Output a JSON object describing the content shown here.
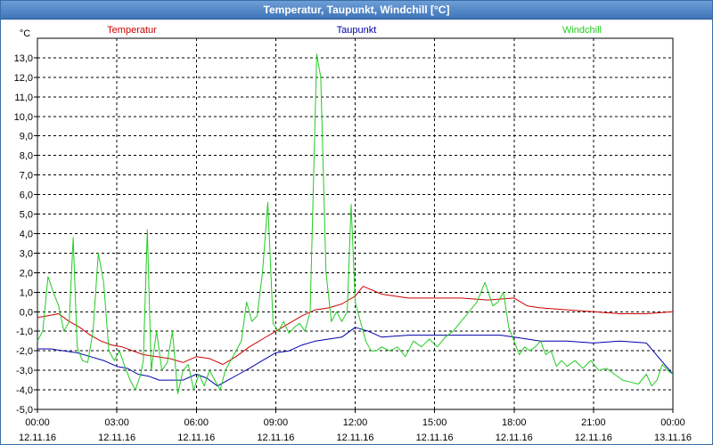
{
  "window": {
    "title": "Temperatur, Taupunkt, Windchill [°C]"
  },
  "colors": {
    "temperatur": "#cc0000",
    "taupunkt": "#0000aa",
    "windchill": "#22cc22",
    "grid": "#000000",
    "axis": "#000000"
  },
  "chart_data": {
    "type": "line",
    "title": "Temperatur, Taupunkt, Windchill [°C]",
    "y_unit": "°C",
    "ylim": [
      -5.0,
      14.0
    ],
    "y_ticks": [
      -5.0,
      -4.0,
      -3.0,
      -2.0,
      -1.0,
      0.0,
      1.0,
      2.0,
      3.0,
      4.0,
      5.0,
      6.0,
      7.0,
      8.0,
      9.0,
      10.0,
      11.0,
      12.0,
      13.0
    ],
    "y_tick_labels": [
      "-5,0",
      "-4,0",
      "-3,0",
      "-2,0",
      "-1,0",
      "0,0",
      "1,0",
      "2,0",
      "3,0",
      "4,0",
      "5,0",
      "6,0",
      "7,0",
      "8,0",
      "9,0",
      "10,0",
      "11,0",
      "12,0",
      "13,0"
    ],
    "xlim": [
      0,
      24
    ],
    "x_ticks": [
      0,
      3,
      6,
      9,
      12,
      15,
      18,
      21,
      24
    ],
    "x_tick_labels": [
      {
        "time": "00:00",
        "date": "12.11.16"
      },
      {
        "time": "03:00",
        "date": "12.11.16"
      },
      {
        "time": "06:00",
        "date": "12.11.16"
      },
      {
        "time": "09:00",
        "date": "12.11.16"
      },
      {
        "time": "12:00",
        "date": "12.11.16"
      },
      {
        "time": "15:00",
        "date": "12.11.16"
      },
      {
        "time": "18:00",
        "date": "12.11.16"
      },
      {
        "time": "21:00",
        "date": "12.11.16"
      },
      {
        "time": "00:00",
        "date": "13.11.16"
      }
    ],
    "grid": true,
    "legend_position": "top",
    "series": [
      {
        "name": "Temperatur",
        "x": [
          0,
          0.4,
          0.8,
          1.2,
          1.6,
          2.0,
          2.4,
          2.8,
          3.2,
          3.6,
          4.0,
          4.5,
          5.0,
          5.5,
          6.0,
          6.5,
          7.0,
          7.5,
          8.0,
          8.5,
          9.0,
          9.5,
          10.0,
          10.5,
          11.0,
          11.5,
          12.0,
          12.3,
          13.0,
          14.0,
          15.0,
          16.0,
          17.0,
          18.0,
          18.5,
          19.0,
          20.0,
          21.0,
          22.0,
          23.0,
          24.0
        ],
        "values": [
          -0.3,
          -0.2,
          -0.1,
          -0.5,
          -0.8,
          -1.2,
          -1.5,
          -1.7,
          -1.8,
          -2.0,
          -2.2,
          -2.3,
          -2.4,
          -2.6,
          -2.3,
          -2.4,
          -2.7,
          -2.3,
          -1.8,
          -1.4,
          -1.0,
          -0.6,
          -0.2,
          0.1,
          0.2,
          0.4,
          0.8,
          1.3,
          0.9,
          0.7,
          0.7,
          0.7,
          0.6,
          0.7,
          0.3,
          0.2,
          0.1,
          0.0,
          -0.1,
          -0.1,
          0.0
        ]
      },
      {
        "name": "Taupunkt",
        "x": [
          0,
          0.5,
          1.0,
          1.5,
          2.0,
          2.5,
          3.0,
          3.4,
          3.8,
          4.2,
          4.6,
          5.0,
          5.5,
          6.0,
          6.4,
          6.8,
          7.2,
          7.6,
          8.0,
          8.5,
          9.0,
          9.5,
          10.0,
          10.5,
          11.0,
          11.5,
          12.0,
          12.5,
          13.0,
          14.0,
          15.0,
          16.0,
          17.0,
          17.5,
          18.0,
          18.5,
          19.0,
          20.0,
          21.0,
          22.0,
          23.0,
          23.5,
          24.0
        ],
        "values": [
          -1.9,
          -1.9,
          -2.0,
          -2.1,
          -2.3,
          -2.5,
          -2.8,
          -2.9,
          -3.2,
          -3.3,
          -3.5,
          -3.5,
          -3.5,
          -3.2,
          -3.4,
          -3.8,
          -3.5,
          -3.2,
          -2.9,
          -2.5,
          -2.1,
          -2.0,
          -1.7,
          -1.5,
          -1.4,
          -1.3,
          -0.8,
          -1.0,
          -1.3,
          -1.2,
          -1.2,
          -1.2,
          -1.2,
          -1.2,
          -1.3,
          -1.4,
          -1.5,
          -1.5,
          -1.6,
          -1.5,
          -1.6,
          -2.4,
          -3.2
        ]
      },
      {
        "name": "Windchill",
        "x": [
          0,
          0.2,
          0.4,
          0.6,
          0.8,
          1.0,
          1.2,
          1.35,
          1.5,
          1.7,
          1.9,
          2.1,
          2.3,
          2.5,
          2.7,
          2.9,
          3.1,
          3.3,
          3.5,
          3.7,
          3.9,
          4.0,
          4.15,
          4.3,
          4.5,
          4.7,
          4.9,
          5.1,
          5.3,
          5.5,
          5.7,
          5.9,
          6.1,
          6.3,
          6.5,
          6.7,
          6.9,
          7.1,
          7.3,
          7.5,
          7.7,
          7.9,
          8.1,
          8.3,
          8.5,
          8.7,
          8.9,
          9.1,
          9.3,
          9.5,
          9.7,
          9.9,
          10.1,
          10.3,
          10.55,
          10.7,
          10.9,
          11.1,
          11.3,
          11.5,
          11.7,
          11.85,
          12.0,
          12.2,
          12.4,
          12.6,
          12.8,
          13.0,
          13.3,
          13.6,
          13.9,
          14.2,
          14.5,
          14.8,
          15.1,
          15.4,
          15.7,
          16.0,
          16.3,
          16.6,
          16.9,
          17.2,
          17.4,
          17.6,
          17.8,
          18.0,
          18.2,
          18.4,
          18.6,
          18.8,
          19.0,
          19.2,
          19.4,
          19.6,
          19.8,
          20.0,
          20.3,
          20.6,
          20.9,
          21.2,
          21.5,
          21.8,
          22.1,
          22.4,
          22.7,
          23.0,
          23.2,
          23.4,
          23.6,
          23.8,
          24.0
        ],
        "values": [
          -1.5,
          -1.0,
          1.8,
          1.0,
          0.3,
          -1.0,
          -0.5,
          3.8,
          -1.8,
          -2.5,
          -2.6,
          -1.0,
          3.0,
          1.5,
          -2.0,
          -2.5,
          -2.0,
          -2.8,
          -3.5,
          -4.0,
          -3.2,
          -2.5,
          4.2,
          -3.0,
          -1.0,
          -3.0,
          -2.6,
          -1.0,
          -4.2,
          -3.0,
          -2.7,
          -4.0,
          -3.2,
          -3.8,
          -3.0,
          -3.5,
          -4.0,
          -3.0,
          -2.5,
          -2.0,
          -1.5,
          0.5,
          -0.5,
          -0.2,
          2.0,
          5.6,
          -0.6,
          -1.0,
          -0.5,
          -1.1,
          -0.8,
          -0.6,
          -1.0,
          0.0,
          13.2,
          12.0,
          2.0,
          -0.5,
          0.0,
          -0.5,
          0.0,
          5.5,
          0.5,
          -0.5,
          -1.5,
          -2.0,
          -2.0,
          -1.8,
          -2.0,
          -1.8,
          -2.3,
          -1.5,
          -1.8,
          -1.4,
          -1.8,
          -1.3,
          -1.0,
          -0.5,
          0.0,
          0.5,
          1.5,
          0.3,
          0.5,
          1.0,
          -0.8,
          -1.5,
          -2.2,
          -1.8,
          -2.0,
          -1.8,
          -1.5,
          -2.2,
          -2.0,
          -2.8,
          -2.5,
          -2.8,
          -2.5,
          -2.9,
          -2.5,
          -3.0,
          -2.9,
          -3.2,
          -3.5,
          -3.6,
          -3.7,
          -3.2,
          -3.8,
          -3.5,
          -2.7,
          -3.0,
          -3.2
        ]
      }
    ]
  }
}
